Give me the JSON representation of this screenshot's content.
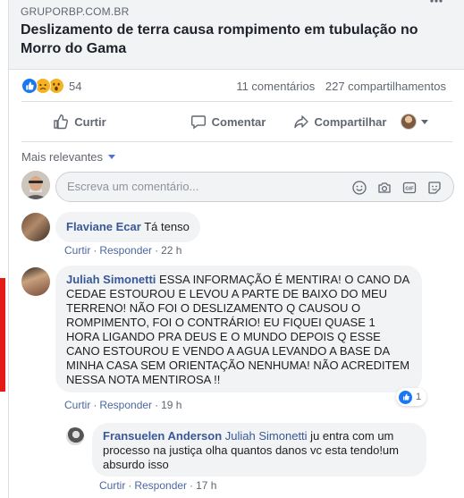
{
  "preview": {
    "source": "GRUPORBP.COM.BR",
    "headline": "Deslizamento de terra causa rompimento em tubulação no Morro do Gama"
  },
  "reactions": {
    "count": "54",
    "comments": "11 comentários",
    "shares": "227 compartilhamentos"
  },
  "actions": {
    "like": "Curtir",
    "comment": "Comentar",
    "share": "Compartilhar"
  },
  "sort": {
    "label": "Mais relevantes"
  },
  "composer": {
    "placeholder": "Escreva um comentário..."
  },
  "comments": [
    {
      "author": "Flaviane Ecar",
      "text": "Tá tenso",
      "like": "Curtir",
      "reply": "Responder",
      "time": "22 h"
    },
    {
      "author": "Juliah Simonetti",
      "text": "ESSA INFORMAÇÃO É MENTIRA! O CANO DA CEDAE ESTOUROU E LEVOU A PARTE DE BAIXO DO MEU TERRENO! NÃO FOI O DESLIZAMENTO Q CAUSOU O ROMPIMENTO, FOI O CONTRÁRIO! EU FIQUEI QUASE 1 HORA LIGANDO PRA DEUS E O MUNDO DEPOIS Q ESSE CANO ESTOUROU E VENDO A AGUA LEVANDO A BASE DA MINHA CASA SEM ORIENTAÇÃO NENHUMA! NÃO ACREDITEM NESSA NOTA MENTIROSA !!",
      "like": "Curtir",
      "reply": "Responder",
      "time": "19 h",
      "reaction_count": "1"
    },
    {
      "author": "Fransuelen Anderson",
      "mention": "Juliah Simonetti",
      "text": " ju entra com um processo na justiça olha quantos danos vc esta tendo!um absurdo isso",
      "like": "Curtir",
      "reply": "Responder",
      "time": "17 h"
    }
  ],
  "colors": {
    "link": "#385898",
    "like_blue": "#1877f2",
    "bubble": "#f2f3f5",
    "highlight": "#e41b17"
  }
}
